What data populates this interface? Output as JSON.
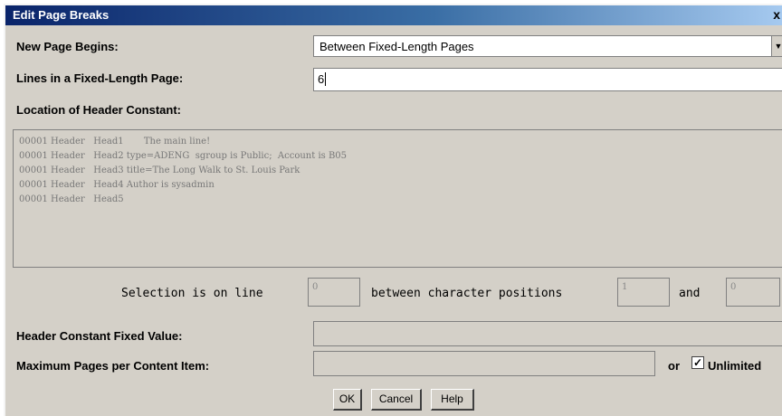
{
  "window": {
    "title": "Edit Page Breaks",
    "close_label": "x"
  },
  "form": {
    "new_page_label": "New Page Begins:",
    "new_page_value": "Between Fixed-Length Pages",
    "lines_label": "Lines in a Fixed-Length Page:",
    "lines_value": "6",
    "location_label": "Location of Header Constant:",
    "header_lines": [
      "00001 Header   Head1       The main line!",
      "00001 Header   Head2 type=ADENG  sgroup is Public;  Account is B05",
      "00001 Header   Head3 title=The Long Walk to St. Louis Park",
      "00001 Header   Head4 Author is sysadmin",
      "00001 Header   Head5"
    ],
    "selection_label": "Selection is on line",
    "selection_line": "0",
    "between_label": "between character positions",
    "char_start": "1",
    "and_label": "and",
    "char_end": "0",
    "fixed_value_label": "Header Constant Fixed Value:",
    "fixed_value": "",
    "max_pages_label": "Maximum Pages per Content Item:",
    "max_pages_value": "",
    "or_label": "or",
    "unlimited_label": "Unlimited",
    "unlimited_checked": true
  },
  "buttons": {
    "ok": "OK",
    "cancel": "Cancel",
    "help": "Help"
  }
}
